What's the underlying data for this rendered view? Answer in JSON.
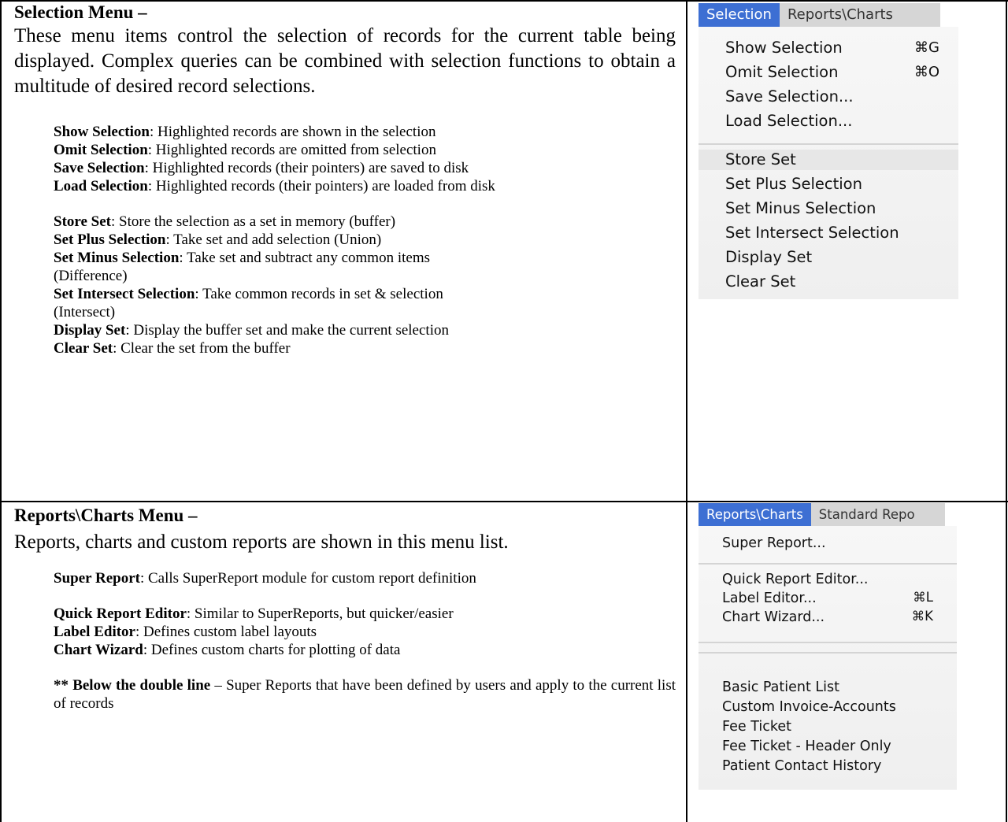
{
  "selection_section": {
    "heading": "Selection Menu –",
    "intro": "These menu items control the selection of records for the current table being displayed.  Complex queries can be combined with selection functions to obtain a multitude of desired record selections.",
    "group1": [
      {
        "term": "Show Selection",
        "desc": ": Highlighted records are shown in the selection"
      },
      {
        "term": "Omit Selection",
        "desc": ": Highlighted records are omitted from selection"
      },
      {
        "term": "Save Selection",
        "desc": ": Highlighted records (their pointers) are saved to disk"
      },
      {
        "term": "Load Selection",
        "desc": ": Highlighted records (their pointers) are loaded from disk"
      }
    ],
    "group2": [
      {
        "term": "Store Set",
        "desc": ": Store the selection as a set in memory (buffer)"
      },
      {
        "term": "Set Plus Selection",
        "desc": ": Take set and add selection (Union)"
      },
      {
        "term": "Set Minus Selection",
        "desc": ": Take set and subtract any common items"
      },
      {
        "term": "",
        "desc": "(Difference)"
      },
      {
        "term": "Set Intersect Selection",
        "desc": ": Take common records in set & selection"
      },
      {
        "term": "",
        "desc": "(Intersect)"
      },
      {
        "term": "Display Set",
        "desc": ": Display the buffer set and make the current selection"
      },
      {
        "term": "Clear Set",
        "desc": ": Clear the set from the buffer"
      }
    ]
  },
  "reports_section": {
    "heading": "Reports\\Charts Menu –",
    "intro": "Reports, charts and custom reports are shown in this menu list.",
    "group1": [
      {
        "term": "Super Report",
        "desc": ":  Calls SuperReport module for custom report definition"
      }
    ],
    "group2": [
      {
        "term": "Quick Report Editor",
        "desc": ": Similar to SuperReports, but quicker/easier"
      },
      {
        "term": "Label Editor",
        "desc": ": Defines custom label layouts"
      },
      {
        "term": "Chart Wizard",
        "desc": ": Defines custom charts for plotting of data"
      }
    ],
    "note_term": "** Below the double line",
    "note_desc": " – Super Reports that have been defined by users and apply to the current list of records"
  },
  "selection_menu": {
    "bar_active": "Selection",
    "bar_next": "Reports\\Charts",
    "items": [
      {
        "label": "Show Selection",
        "shortcut": "⌘G"
      },
      {
        "label": "Omit Selection",
        "shortcut": "⌘O"
      },
      {
        "label": "Save Selection...",
        "shortcut": ""
      },
      {
        "label": "Load Selection...",
        "shortcut": ""
      },
      {
        "label": "Store Set",
        "shortcut": ""
      },
      {
        "label": "Set Plus Selection",
        "shortcut": ""
      },
      {
        "label": "Set Minus Selection",
        "shortcut": ""
      },
      {
        "label": "Set Intersect Selection",
        "shortcut": ""
      },
      {
        "label": "Display Set",
        "shortcut": ""
      },
      {
        "label": "Clear Set",
        "shortcut": ""
      }
    ]
  },
  "reports_menu": {
    "bar_active": "Reports\\Charts",
    "bar_next": "Standard Repo",
    "items": [
      {
        "label": "Super Report...",
        "shortcut": ""
      },
      {
        "label": "Quick Report Editor...",
        "shortcut": ""
      },
      {
        "label": "Label Editor...",
        "shortcut": "⌘L"
      },
      {
        "label": "Chart Wizard...",
        "shortcut": "⌘K"
      },
      {
        "label": "Basic Patient List",
        "shortcut": ""
      },
      {
        "label": "Custom Invoice-Accounts",
        "shortcut": ""
      },
      {
        "label": "Fee Ticket",
        "shortcut": ""
      },
      {
        "label": "Fee Ticket - Header Only",
        "shortcut": ""
      },
      {
        "label": "Patient Contact History",
        "shortcut": ""
      }
    ]
  }
}
